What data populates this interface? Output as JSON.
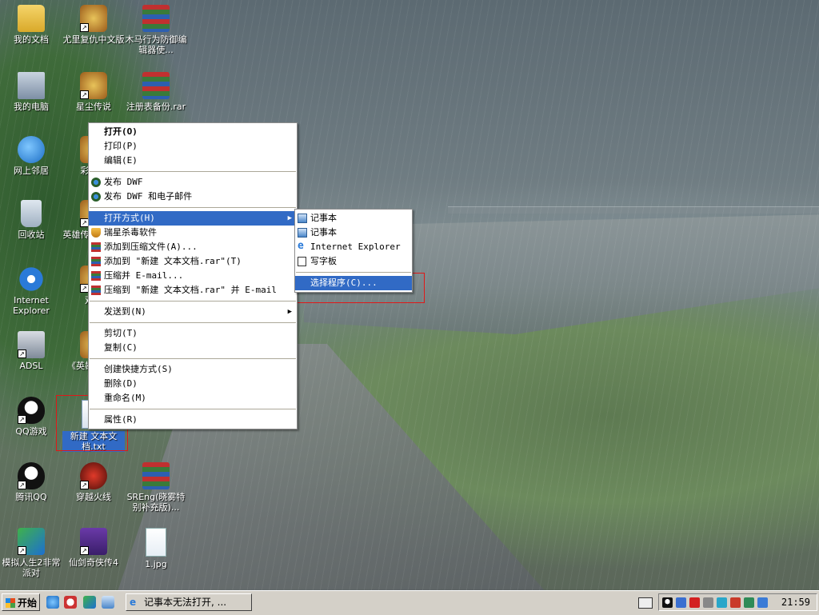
{
  "desktop": {
    "icons": [
      {
        "label": "我的文档"
      },
      {
        "label": "尤里复仇中文版"
      },
      {
        "label": "木马行为防御编辑器使..."
      },
      {
        "label": "我的电脑"
      },
      {
        "label": "星尘传说"
      },
      {
        "label": "注册表备份.rar"
      },
      {
        "label": "网上邻居"
      },
      {
        "label": "彩虹岛"
      },
      {
        "label": "回收站"
      },
      {
        "label": "英雄传说之轨迹"
      },
      {
        "label": "Internet Explorer"
      },
      {
        "label": "双星"
      },
      {
        "label": "ADSL"
      },
      {
        "label": "《英雄》空之"
      },
      {
        "label": "QQ游戏"
      },
      {
        "label": "新建 文本文档.txt"
      },
      {
        "label": "腾讯QQ"
      },
      {
        "label": "穿越火线"
      },
      {
        "label": "SREng(晓雾特别补充版)..."
      },
      {
        "label": "模拟人生2非常派对"
      },
      {
        "label": "仙剑奇侠传4"
      },
      {
        "label": "1.jpg"
      }
    ]
  },
  "context_menu": {
    "items": [
      {
        "label": "打开(O)"
      },
      {
        "label": "打印(P)"
      },
      {
        "label": "编辑(E)"
      },
      {
        "label": "发布 DWF"
      },
      {
        "label": "发布 DWF 和电子邮件"
      },
      {
        "label": "打开方式(H)"
      },
      {
        "label": "瑞星杀毒软件"
      },
      {
        "label": "添加到压缩文件(A)..."
      },
      {
        "label": "添加到 \"新建 文本文档.rar\"(T)"
      },
      {
        "label": "压缩并 E-mail..."
      },
      {
        "label": "压缩到 \"新建 文本文档.rar\" 并 E-mail"
      },
      {
        "label": "发送到(N)"
      },
      {
        "label": "剪切(T)"
      },
      {
        "label": "复制(C)"
      },
      {
        "label": "创建快捷方式(S)"
      },
      {
        "label": "删除(D)"
      },
      {
        "label": "重命名(M)"
      },
      {
        "label": "属性(R)"
      }
    ]
  },
  "open_with_submenu": {
    "items": [
      {
        "label": "记事本"
      },
      {
        "label": "记事本"
      },
      {
        "label": "Internet Explorer"
      },
      {
        "label": "写字板"
      },
      {
        "label": "选择程序(C)..."
      }
    ]
  },
  "taskbar": {
    "start_label": "开始",
    "task_button_label": "记事本无法打开, ...",
    "clock": "21:59"
  }
}
